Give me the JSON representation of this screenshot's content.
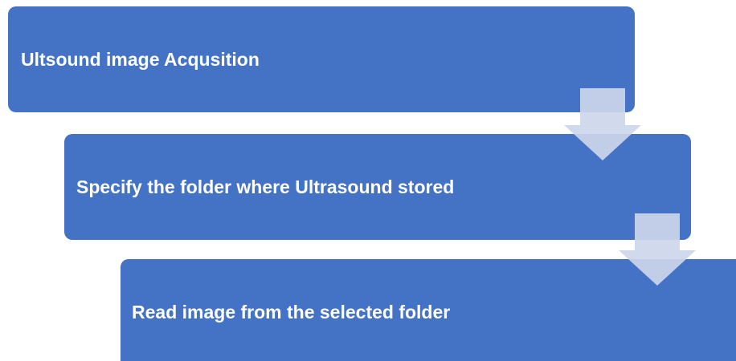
{
  "flow": {
    "steps": [
      {
        "label": "Ultsound image Acqusition"
      },
      {
        "label": "Specify the folder where Ultrasound  stored"
      },
      {
        "label": "Read image from the selected folder"
      }
    ]
  },
  "colors": {
    "box": "#4472c4",
    "arrow": "#cdd6ea",
    "text": "#ffffff"
  },
  "icons": {
    "connector": "down-arrow-icon"
  }
}
